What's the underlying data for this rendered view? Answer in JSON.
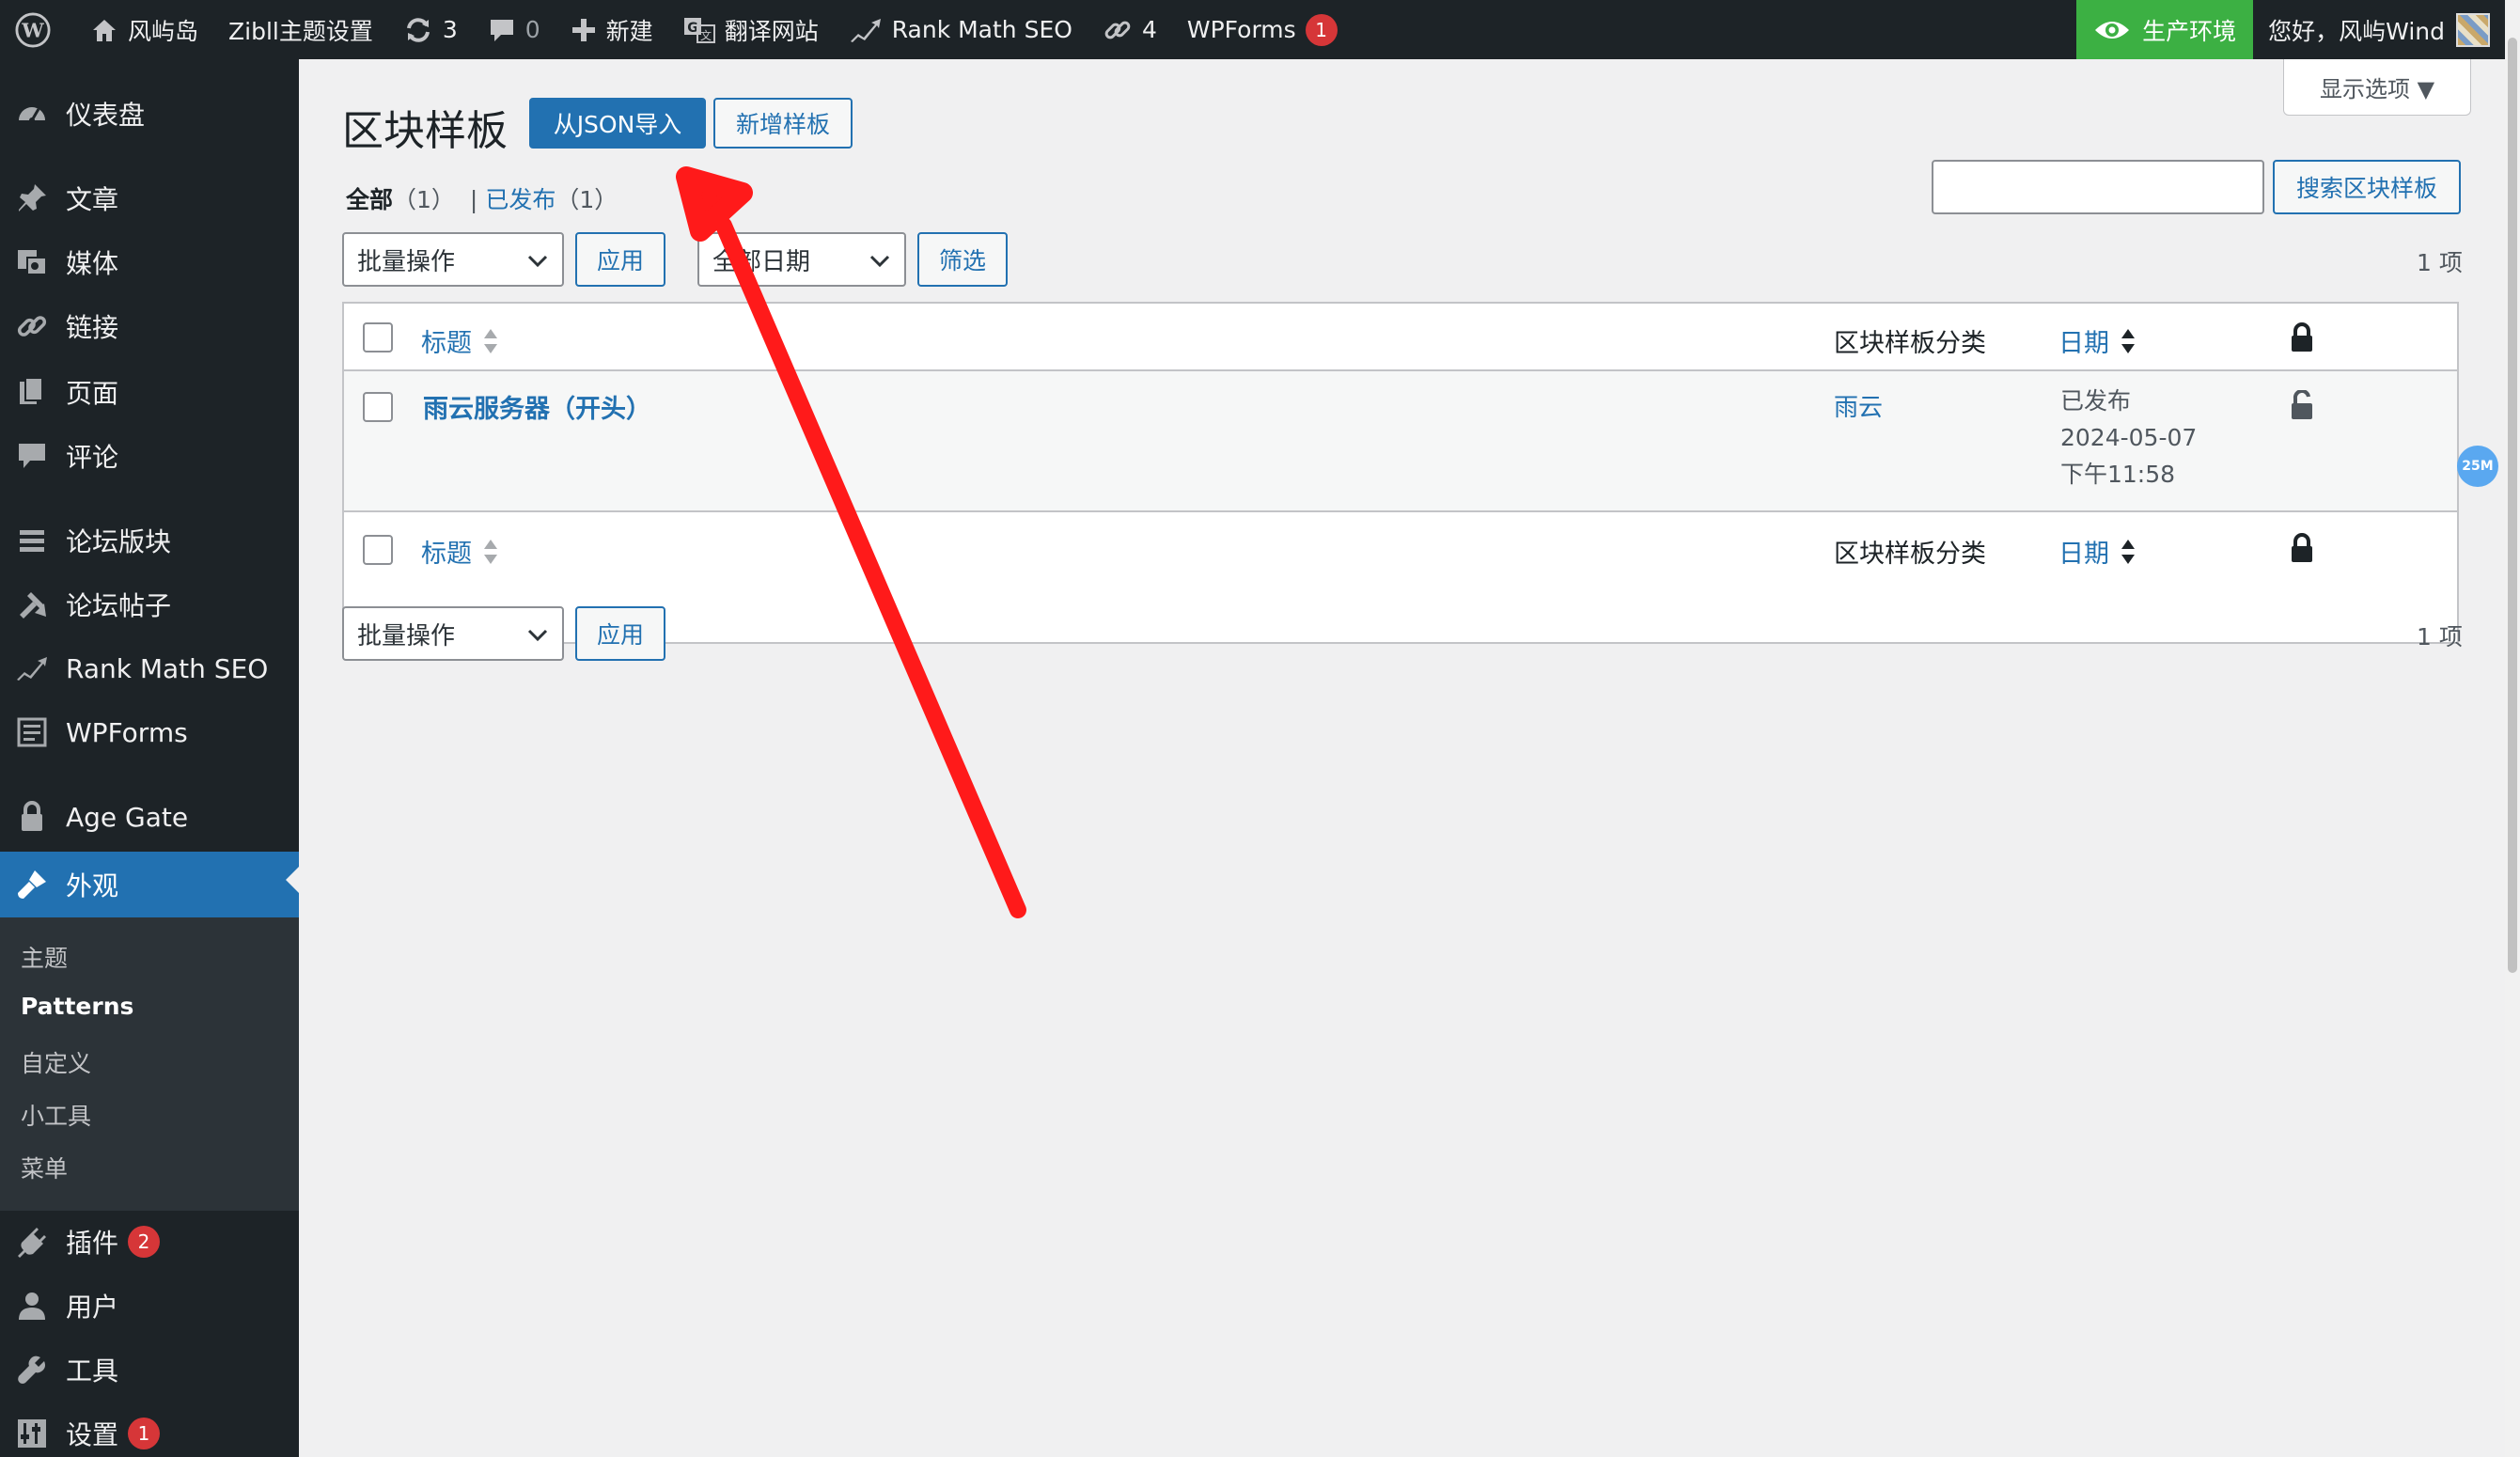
{
  "adminbar": {
    "site_name": "风屿岛",
    "theme_settings": "Zibll主题设置",
    "updates_count": "3",
    "comments_count": "0",
    "new_label": "新建",
    "translate_label": "翻译网站",
    "rankmath_label": "Rank Math SEO",
    "links_count": "4",
    "wpforms_label": "WPForms",
    "wpforms_badge": "1",
    "env_label": "生产环境",
    "greeting": "您好，风屿Wind"
  },
  "sidebar": {
    "items": [
      {
        "label": "仪表盘"
      },
      {
        "label": "文章"
      },
      {
        "label": "媒体"
      },
      {
        "label": "链接"
      },
      {
        "label": "页面"
      },
      {
        "label": "评论"
      },
      {
        "label": "论坛版块"
      },
      {
        "label": "论坛帖子"
      },
      {
        "label": "Rank Math SEO"
      },
      {
        "label": "WPForms"
      },
      {
        "label": "Age Gate"
      },
      {
        "label": "外观"
      },
      {
        "label": "插件",
        "badge": "2"
      },
      {
        "label": "用户"
      },
      {
        "label": "工具"
      },
      {
        "label": "设置",
        "badge": "1"
      }
    ],
    "submenu": [
      "主题",
      "Patterns",
      "自定义",
      "小工具",
      "菜单"
    ]
  },
  "main": {
    "screen_options": "显示选项 ▼",
    "title": "区块样板",
    "import_button": "从JSON导入",
    "add_button": "新增样板",
    "filter_all": "全部",
    "filter_all_count": "（1）",
    "filter_sep": "|",
    "filter_published": "已发布",
    "filter_published_count": "（1）",
    "search_button": "搜索区块样板",
    "bulk_actions": "批量操作",
    "apply": "应用",
    "all_dates": "全部日期",
    "filter_button": "筛选",
    "items_count": "1 项",
    "table": {
      "col_title": "标题",
      "col_category": "区块样板分类",
      "col_date": "日期",
      "rows": [
        {
          "title": "雨云服务器（开头）",
          "category": "雨云",
          "status": "已发布",
          "date": "2024-05-07",
          "time": "下午11:58"
        }
      ]
    },
    "float_badge": "25M"
  },
  "colors": {
    "accent": "#2271b1",
    "adminbar": "#1d2327",
    "env_green": "#3cb043",
    "annotation_arrow": "#ff1a1a"
  }
}
